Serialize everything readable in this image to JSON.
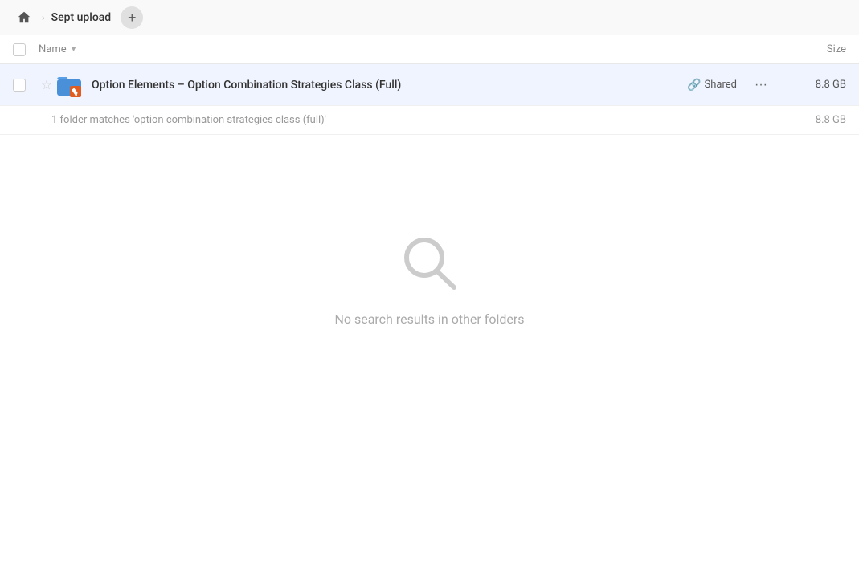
{
  "topbar": {
    "home_label": "Home",
    "breadcrumb_label": "Sept upload",
    "add_button_label": "+"
  },
  "header": {
    "name_column": "Name",
    "size_column": "Size"
  },
  "file_row": {
    "name": "Option Elements – Option Combination Strategies Class (Full)",
    "shared_label": "Shared",
    "size": "8.8 GB",
    "starred": false
  },
  "summary": {
    "text": "1 folder matches 'option combination strategies class (full)'",
    "size": "8.8 GB"
  },
  "empty_state": {
    "message": "No search results in other folders"
  }
}
